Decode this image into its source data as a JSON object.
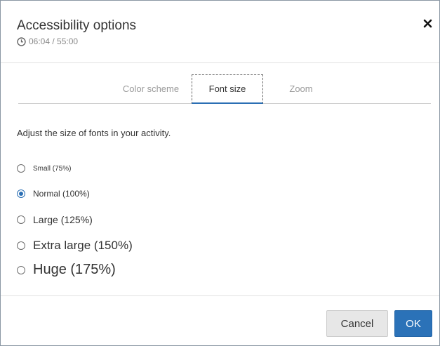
{
  "dialog": {
    "title": "Accessibility options",
    "timer": "06:04 / 55:00"
  },
  "tabs": [
    {
      "label": "Color scheme",
      "selected": false
    },
    {
      "label": "Font size",
      "selected": true
    },
    {
      "label": "Zoom",
      "selected": false
    }
  ],
  "font_size": {
    "description": "Adjust the size of fonts in your activity.",
    "options": [
      {
        "label": "Small (75%)",
        "checked": false
      },
      {
        "label": "Normal (100%)",
        "checked": true
      },
      {
        "label": "Large (125%)",
        "checked": false
      },
      {
        "label": "Extra large (150%)",
        "checked": false
      },
      {
        "label": "Huge (175%)",
        "checked": false
      }
    ]
  },
  "buttons": {
    "cancel": "Cancel",
    "ok": "OK"
  },
  "colors": {
    "accent": "#2b72b8",
    "selected_tab_underline": "#2b6fb4",
    "cancel_bg": "#e7e7e7"
  },
  "icons": {
    "timer": "clock-icon",
    "close": "close-icon"
  }
}
